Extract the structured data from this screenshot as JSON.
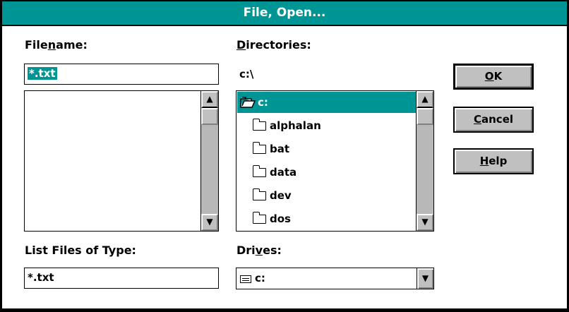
{
  "window": {
    "title": "File, Open..."
  },
  "filename": {
    "label": "File",
    "label_u": "n",
    "label_rest": "ame:",
    "value": "*.txt"
  },
  "directories": {
    "label_u": "D",
    "label_rest": "irectories:",
    "path": "c:\\",
    "items": [
      {
        "name": "c:",
        "icon": "open-folder-icon",
        "selected": true
      },
      {
        "name": "alphalan",
        "icon": "folder-icon"
      },
      {
        "name": "bat",
        "icon": "folder-icon"
      },
      {
        "name": "data",
        "icon": "folder-icon"
      },
      {
        "name": "dev",
        "icon": "folder-icon"
      },
      {
        "name": "dos",
        "icon": "folder-icon"
      }
    ]
  },
  "file_type": {
    "label": "List Files of Type:",
    "value": "*.txt"
  },
  "drives": {
    "label_pre": "Dri",
    "label_u": "v",
    "label_rest": "es:",
    "value": "c:",
    "icon": "drive-icon"
  },
  "buttons": {
    "ok_u": "O",
    "ok_rest": "K",
    "cancel_u": "C",
    "cancel_rest": "ancel",
    "help_u": "H",
    "help_rest": "elp"
  },
  "icons": {
    "scroll_up": "▲",
    "scroll_down": "▼",
    "combo_down": "▼"
  },
  "colors": {
    "title_bar": "#009595",
    "selection": "#009595",
    "button_face": "#c0c0c0",
    "scroll_track": "#b8b8b8"
  }
}
